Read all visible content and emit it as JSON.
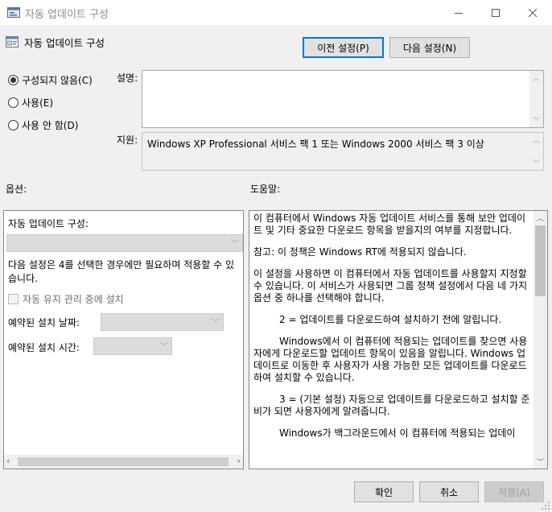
{
  "window": {
    "title": "자동 업데이트 구성",
    "minimize_icon": "minimize-icon",
    "maximize_icon": "maximize-icon",
    "close_icon": "close-icon"
  },
  "header": {
    "policy_title": "자동 업데이트 구성",
    "prev_button": "이전 설정(P)",
    "next_button": "다음 설정(N)"
  },
  "state": {
    "options": [
      {
        "label": "구성되지 않음(C)",
        "selected": true
      },
      {
        "label": "사용(E)",
        "selected": false
      },
      {
        "label": "사용 안 함(D)",
        "selected": false
      }
    ]
  },
  "description": {
    "label": "설명:",
    "value": ""
  },
  "supported": {
    "label": "지원:",
    "value": "Windows XP Professional 서비스 팩 1 또는 Windows 2000 서비스 팩 3 이상"
  },
  "options_section": {
    "label": "옵션:",
    "configure_label": "자동 업데이트 구성:",
    "configure_value": "",
    "note": "다음 설정은 4를 선택한 경우에만 필요하며 적용할 수 있습니다.",
    "maintenance_checkbox": "자동 유지 관리 중에 설치",
    "scheduled_day_label": "예약된 설치 날짜:",
    "scheduled_time_label": "예약된 설치 시간:"
  },
  "help_section": {
    "label": "도움말:",
    "paragraphs": [
      "이 컴퓨터에서 Windows 자동 업데이트 서비스를 통해 보안 업데이트 및 기타 중요한 다운로드 항목을 받을지의 여부를 지정합니다.",
      "참고: 이 정책은 Windows RT에 적용되지 않습니다.",
      "이 설정을 사용하면 이 컴퓨터에서 자동 업데이트를 사용할지 지정할 수 있습니다. 이 서비스가 사용되면 그룹 정책 설정에서 다음 네 가지 옵션 중 하나를 선택해야 합니다.",
      "2 = 업데이트를 다운로드하여 설치하기 전에 알립니다.",
      "Windows에서 이 컴퓨터에 적용되는 업데이트를 찾으면 사용자에게 다운로드할 업데이트 항목이 있음을 알립니다. Windows 업데이트로 이동한 후 사용자가 사용 가능한 모든 업데이트를 다운로드하여 설치할 수 있습니다.",
      "3 = (기본 설정) 자동으로 업데이트를 다운로드하고 설치할 준비가 되면 사용자에게 알려줍니다.",
      "Windows가 백그라운드에서 이 컴퓨터에 적용되는 업데이"
    ]
  },
  "footer": {
    "ok": "확인",
    "cancel": "취소",
    "apply": "적용(A)"
  }
}
